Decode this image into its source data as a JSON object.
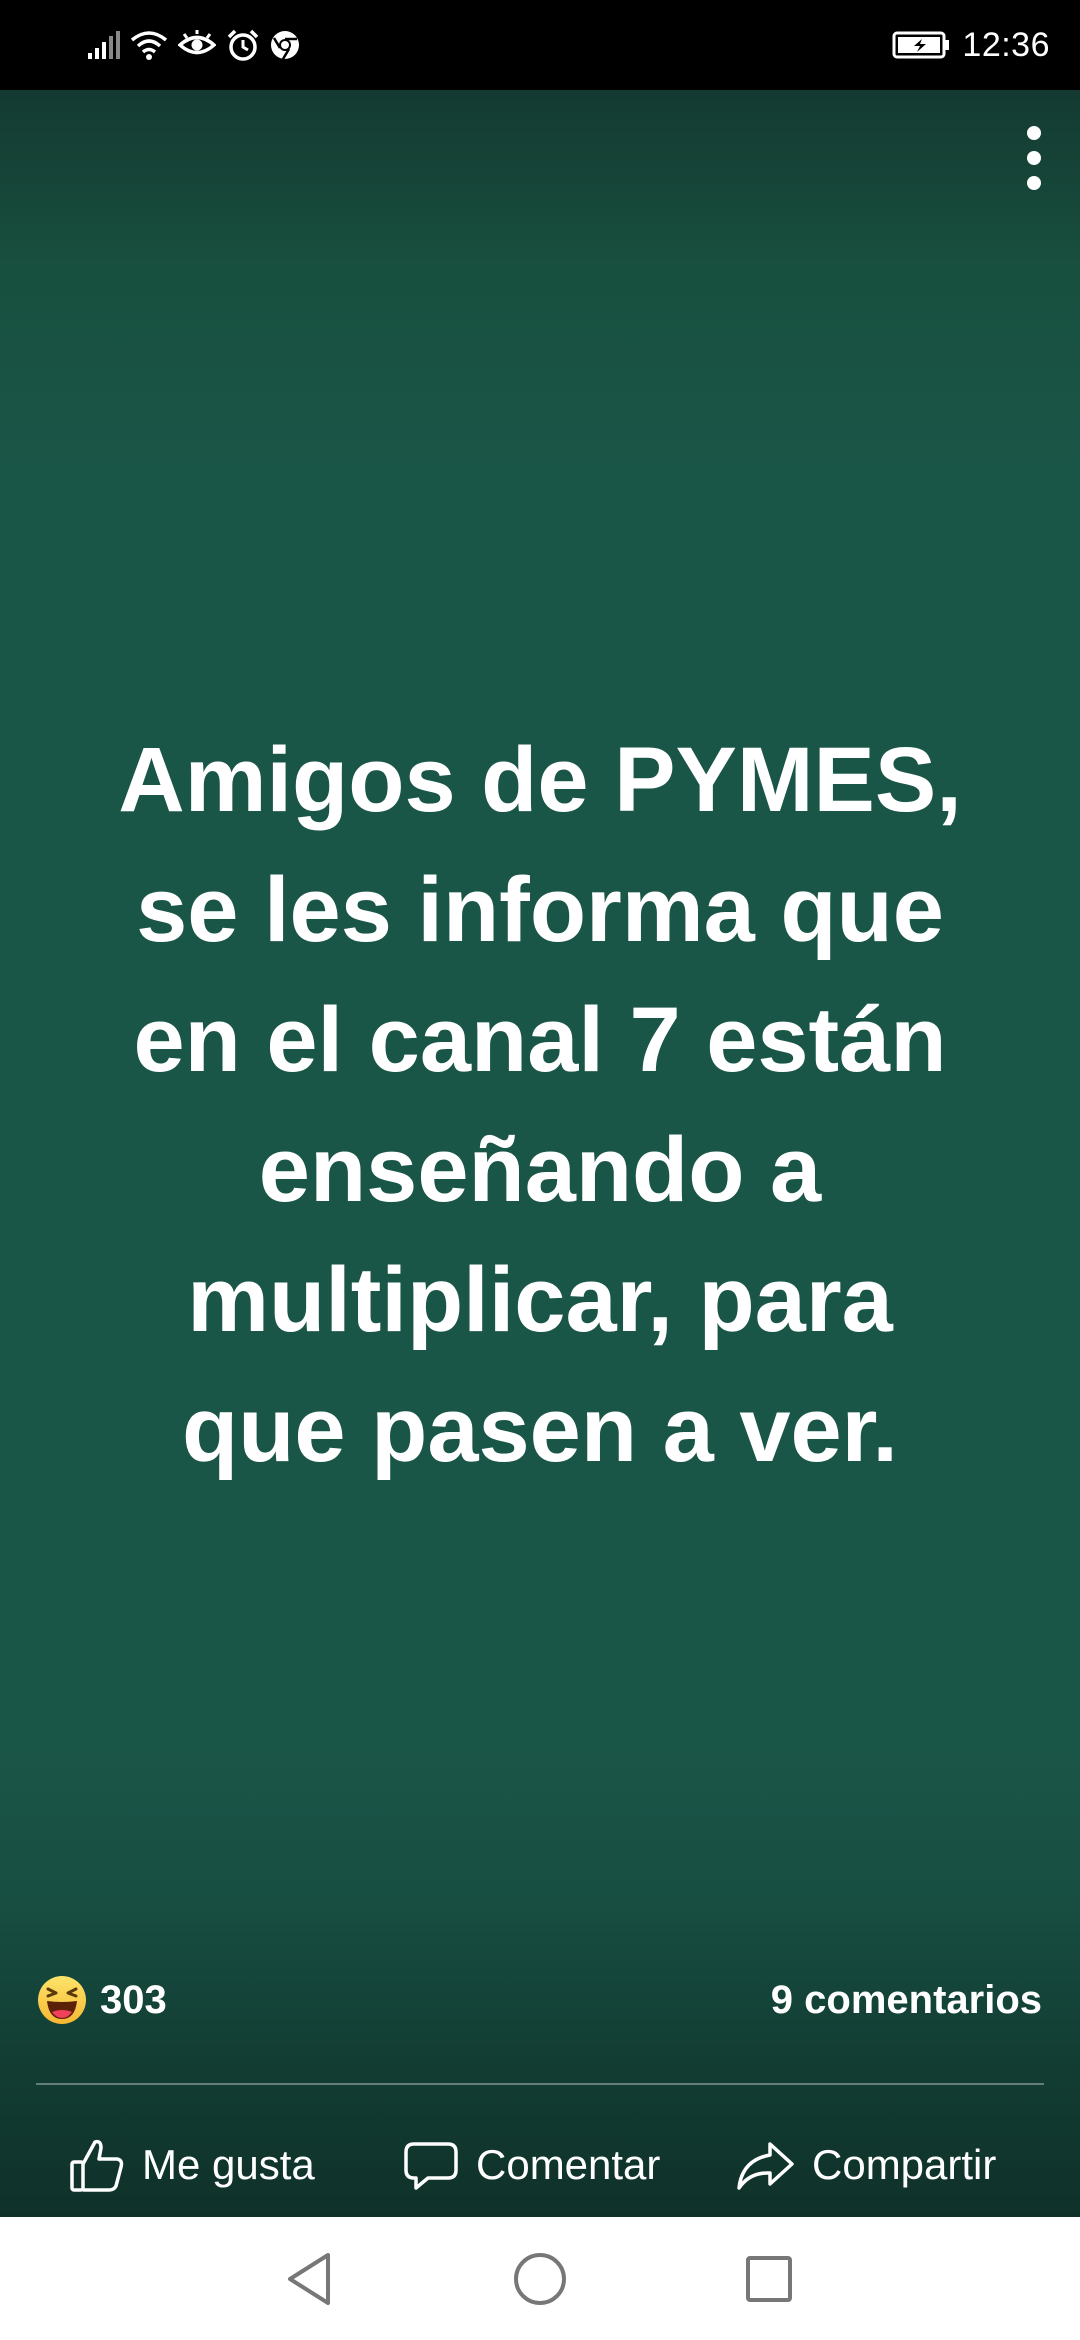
{
  "status_bar": {
    "time": "12:36",
    "icons": [
      "signal-icon",
      "wifi-icon",
      "eye-icon",
      "alarm-icon",
      "chrome-icon",
      "battery-charging-icon"
    ]
  },
  "post": {
    "text": "Amigos de PYMES,\nse les informa que\nen el canal 7 están\nenseñando a\nmultiplicar, para\nque pasen a ver.",
    "background_color": "#1a5648",
    "reaction_icon": "haha-emoji-icon",
    "reaction_count": "303",
    "comments_count": "9 comentarios"
  },
  "actions": {
    "like_label": "Me gusta",
    "comment_label": "Comentar",
    "share_label": "Compartir"
  },
  "nav_bar": {
    "buttons": [
      "back-icon",
      "home-icon",
      "recents-icon"
    ]
  }
}
